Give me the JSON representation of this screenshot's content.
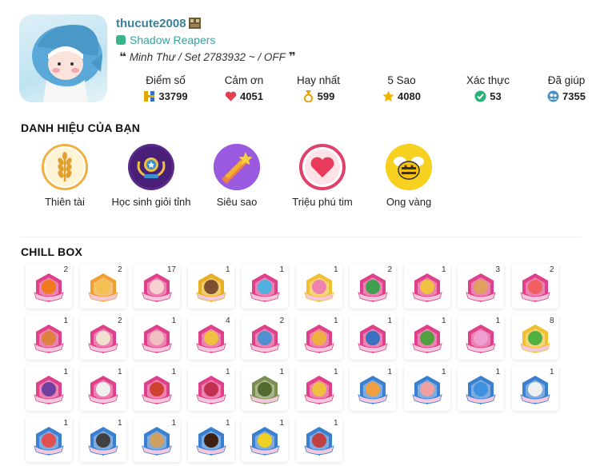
{
  "profile": {
    "username": "thucute2008",
    "guild": "Shadow Reapers",
    "status": "Minh Thư / Set 2783932 ~ / OFF"
  },
  "stats": [
    {
      "label": "Điểm số",
      "value": "33799",
      "icon": "points-icon",
      "color": "#e0a800"
    },
    {
      "label": "Cảm ơn",
      "value": "4051",
      "icon": "heart-icon",
      "color": "#e04050"
    },
    {
      "label": "Hay nhất",
      "value": "599",
      "icon": "medal-icon",
      "color": "#e8a000"
    },
    {
      "label": "5 Sao",
      "value": "4080",
      "icon": "star-icon",
      "color": "#f0b400"
    },
    {
      "label": "Xác thực",
      "value": "53",
      "icon": "verified-icon",
      "color": "#2bb07a"
    },
    {
      "label": "Đã giúp",
      "value": "7355",
      "icon": "people-icon",
      "color": "#4a90c0"
    }
  ],
  "titles_section": "DANH HIỆU CỦA BẠN",
  "titles": [
    {
      "label": "Thiên tài",
      "icon": "wheat-icon"
    },
    {
      "label": "Học sinh giỏi tỉnh",
      "icon": "trophy-icon"
    },
    {
      "label": "Siêu sao",
      "icon": "shooting-star-icon"
    },
    {
      "label": "Triệu phú tim",
      "icon": "heart-icon"
    },
    {
      "label": "Ong vàng",
      "icon": "bee-icon"
    }
  ],
  "chillbox_section": "CHILL BOX",
  "badges": [
    {
      "count": "2",
      "icon": "pumpkin-badge-icon",
      "frame": "#e0408a",
      "inner": "#f07a20"
    },
    {
      "count": "2",
      "icon": "mooncake-badge-icon",
      "frame": "#f0a030",
      "inner": "#f4c050"
    },
    {
      "count": "17",
      "icon": "egg-badge-icon",
      "frame": "#e0408a",
      "inner": "#f7d0d0"
    },
    {
      "count": "1",
      "icon": "cake-badge-icon",
      "frame": "#e8b020",
      "inner": "#7a5030"
    },
    {
      "count": "1",
      "icon": "bottle-badge-icon",
      "frame": "#e0408a",
      "inner": "#50b0e0"
    },
    {
      "count": "1",
      "icon": "candy-badge-icon",
      "frame": "#f0c030",
      "inner": "#f080b0"
    },
    {
      "count": "2",
      "icon": "turtle-badge-icon",
      "frame": "#e0408a",
      "inner": "#40a050"
    },
    {
      "count": "1",
      "icon": "flower-badge-icon",
      "frame": "#e0408a",
      "inner": "#f0c040"
    },
    {
      "count": "3",
      "icon": "spoon-badge-icon",
      "frame": "#e0408a",
      "inner": "#e0a060"
    },
    {
      "count": "2",
      "icon": "mushroom-badge-icon",
      "frame": "#e0408a",
      "inner": "#f06060"
    },
    {
      "count": "1",
      "icon": "drumstick-badge-icon",
      "frame": "#e0408a",
      "inner": "#e08040"
    },
    {
      "count": "2",
      "icon": "cat-badge-icon",
      "frame": "#e0408a",
      "inner": "#f0e0d0"
    },
    {
      "count": "1",
      "icon": "icecream-badge-icon",
      "frame": "#e0408a",
      "inner": "#f0c0c0"
    },
    {
      "count": "4",
      "icon": "bow-badge-icon",
      "frame": "#e0408a",
      "inner": "#f0c040"
    },
    {
      "count": "2",
      "icon": "drink-badge-icon",
      "frame": "#e0408a",
      "inner": "#5090d0"
    },
    {
      "count": "1",
      "icon": "monkey-badge-icon",
      "frame": "#e0408a",
      "inner": "#f0b040"
    },
    {
      "count": "1",
      "icon": "ring-badge-icon",
      "frame": "#e0408a",
      "inner": "#3a70c0"
    },
    {
      "count": "1",
      "icon": "frog-badge-icon",
      "frame": "#e0408a",
      "inner": "#50a040"
    },
    {
      "count": "1",
      "icon": "gift-badge-icon",
      "frame": "#e0408a",
      "inner": "#f0a0d0"
    },
    {
      "count": "8",
      "icon": "clover-badge-icon",
      "frame": "#f0c030",
      "inner": "#50b040"
    },
    {
      "count": "1",
      "icon": "witch-hat-badge-icon",
      "frame": "#e0408a",
      "inner": "#7040a0"
    },
    {
      "count": "1",
      "icon": "snowman-badge-icon",
      "frame": "#e0408a",
      "inner": "#f0f0f0"
    },
    {
      "count": "1",
      "icon": "dragon-badge-icon",
      "frame": "#e0408a",
      "inner": "#d04030"
    },
    {
      "count": "1",
      "icon": "leaf-badge-icon",
      "frame": "#e0408a",
      "inner": "#c03050"
    },
    {
      "count": "1",
      "icon": "turtle-hat-badge-icon",
      "frame": "#7a8f50",
      "inner": "#506a30"
    },
    {
      "count": "1",
      "icon": "dog-badge-icon",
      "frame": "#e0408a",
      "inner": "#f0c040"
    },
    {
      "count": "1",
      "icon": "pizza-badge-icon",
      "frame": "#3a80d0",
      "inner": "#f0a040"
    },
    {
      "count": "1",
      "icon": "girl-badge-icon",
      "frame": "#3a80d0",
      "inner": "#f0a0a0"
    },
    {
      "count": "1",
      "icon": "robot-cat-badge-icon",
      "frame": "#3a80d0",
      "inner": "#4090e0"
    },
    {
      "count": "1",
      "icon": "chef-badge-icon",
      "frame": "#3a80d0",
      "inner": "#f0f0f0"
    },
    {
      "count": "1",
      "icon": "cube-badge-icon",
      "frame": "#3a80d0",
      "inner": "#e05050"
    },
    {
      "count": "1",
      "icon": "calculator-badge-icon",
      "frame": "#3a80d0",
      "inner": "#404040"
    },
    {
      "count": "1",
      "icon": "scroll-badge-icon",
      "frame": "#3a80d0",
      "inner": "#d0a060"
    },
    {
      "count": "1",
      "icon": "door-badge-icon",
      "frame": "#3a80d0",
      "inner": "#402010"
    },
    {
      "count": "1",
      "icon": "pikachu-badge-icon",
      "frame": "#3a80d0",
      "inner": "#f0d020"
    },
    {
      "count": "1",
      "icon": "book-badge-icon",
      "frame": "#3a80d0",
      "inner": "#c04040"
    }
  ]
}
